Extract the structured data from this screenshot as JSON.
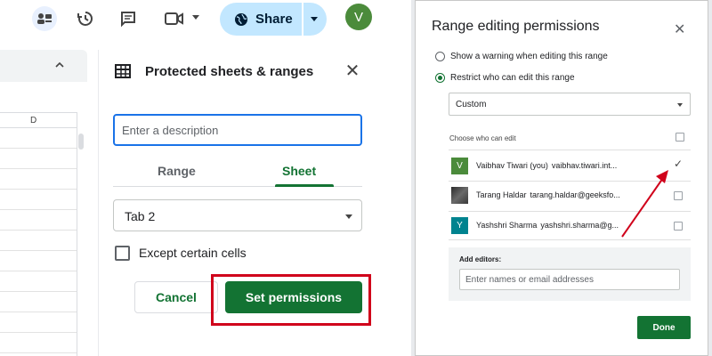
{
  "sheets": {
    "topbar": {
      "share_label": "Share",
      "avatar_initial": "V"
    },
    "grid": {
      "column_header": "D"
    },
    "protected_panel": {
      "title": "Protected sheets & ranges",
      "description_placeholder": "Enter a description",
      "tabs": [
        {
          "label": "Range",
          "active": false
        },
        {
          "label": "Sheet",
          "active": true
        }
      ],
      "selected_sheet": "Tab 2",
      "except_label": "Except certain cells",
      "cancel_label": "Cancel",
      "set_permissions_label": "Set permissions"
    }
  },
  "dialog": {
    "title": "Range editing permissions",
    "options": [
      {
        "label": "Show a warning when editing this range",
        "selected": false
      },
      {
        "label": "Restrict who can edit this range",
        "selected": true
      }
    ],
    "restrict_mode": "Custom",
    "choose_label": "Choose who can edit",
    "users": [
      {
        "initial": "V",
        "name": "Vaibhav Tiwari (you)",
        "email": "vaibhav.tiwari.int...",
        "checked": true,
        "avatar": "green"
      },
      {
        "initial": "",
        "name": "Tarang Haldar",
        "email": "tarang.haldar@geeksfo...",
        "checked": false,
        "avatar": "photo"
      },
      {
        "initial": "Y",
        "name": "Yashshri Sharma",
        "email": "yashshri.sharma@g...",
        "checked": false,
        "avatar": "teal"
      }
    ],
    "add_editors_label": "Add editors:",
    "add_editors_placeholder": "Enter names or email addresses",
    "done_label": "Done"
  },
  "colors": {
    "accent_green": "#137333",
    "highlight_red": "#d0021b",
    "share_blue": "#c2e7ff"
  }
}
